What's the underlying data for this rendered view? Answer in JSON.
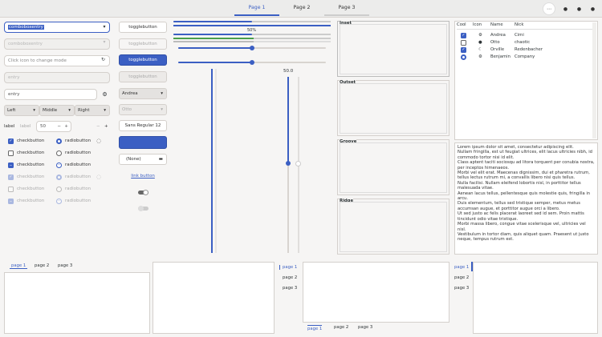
{
  "header": {
    "tabs": [
      "Page 1",
      "Page 2",
      "Page 3"
    ],
    "active": 0,
    "menu_icon": "more-icon",
    "icons": [
      "circle-icon",
      "circle-icon",
      "circle-icon"
    ]
  },
  "col1": {
    "combo_entry": "comboboxentry",
    "combo_entry_dis": "comboboxentry",
    "mode_placeholder": "Click icon to change mode",
    "entry_dis": "entry",
    "entry": "entry",
    "segments": [
      "Left",
      "Middle",
      "Right"
    ],
    "spin_label": "label",
    "spin_label_dis": "label",
    "spin_value": "50",
    "checks": [
      {
        "label": "checkbutton",
        "state": "on"
      },
      {
        "label": "checkbutton",
        "state": "off"
      },
      {
        "label": "checkbutton",
        "state": "ind"
      },
      {
        "label": "checkbutton",
        "state": "on-dim"
      },
      {
        "label": "checkbutton",
        "state": "off-dim"
      },
      {
        "label": "checkbutton",
        "state": "ind-dim"
      }
    ],
    "radios": [
      {
        "label": "radiobutton",
        "state": "on"
      },
      {
        "label": "radiobutton",
        "state": "off"
      },
      {
        "label": "radiobutton",
        "state": "ind"
      },
      {
        "label": "radiobutton",
        "state": "on-dim"
      },
      {
        "label": "radiobutton",
        "state": "off-dim"
      },
      {
        "label": "radiobutton",
        "state": "ind-dim"
      }
    ]
  },
  "col2": {
    "toggle": "togglebutton",
    "toggle_dis": "togglebutton",
    "toggle_act": "togglebutton",
    "toggle_act_dis": "togglebutton",
    "combo": "Andrea",
    "combo_dis": "Otto",
    "font": "Sans Regular",
    "font_size": "12",
    "file": "(None)",
    "link": "link button"
  },
  "col3": {
    "progress_label": "50%",
    "scale_value": "50.0"
  },
  "col4": {
    "frames": [
      "Inset",
      "Outset",
      "Groove",
      "Ridge"
    ]
  },
  "col5": {
    "tree_headers": [
      "Cool",
      "Icon",
      "Name",
      "Nick"
    ],
    "tree_rows": [
      {
        "cool": "on",
        "icon": "gear-icon",
        "name": "Andrea",
        "nick": "Cimi"
      },
      {
        "cool": "off",
        "icon": "circle-icon",
        "name": "Otto",
        "nick": "chaotic"
      },
      {
        "cool": "on",
        "icon": "moon-icon",
        "name": "Orville",
        "nick": "Redenbacher"
      },
      {
        "cool": "radio",
        "icon": "gear-icon",
        "name": "Benjamin",
        "nick": "Company"
      }
    ],
    "text": "Lorem ipsum dolor sit amet, consectetur adipiscing elit.\nNullam fringilla, est ut feugiat ultrices, elit lacus ultricies nibh, id commodo tortor nisi id elit.\nClass aptent taciti sociosqu ad litora torquent per conubia nostra, per inceptos himenaeos.\nMorbi vel elit erat. Maecenas dignissim, dui et pharetra rutrum, tellus lectus rutrum mi, a convallis libero nisi quis tellus.\nNulla facilisi. Nullam eleifend lobortis nisl, in porttitor tellus malesuada vitae.\nAenean lacus tellus, pellentesque quis molestie quis, fringilla in arcu.\nDuis elementum, tellus sed tristique semper, metus metus accumsan augue, et porttitor augue orci a libero.\nUt sed justo ac felis placerat laoreet sed id sem. Proin mattis tincidunt odio vitae tristique.\nMorbi massa libero, congue vitae scelerisque vel, ultricies vel nisl.\nVestibulum in tortor diam, quis aliquet quam. Praesent ut justo neque, tempus rutrum est."
  },
  "notebooks": {
    "tabs": [
      "page 1",
      "page 2",
      "page 3"
    ]
  }
}
